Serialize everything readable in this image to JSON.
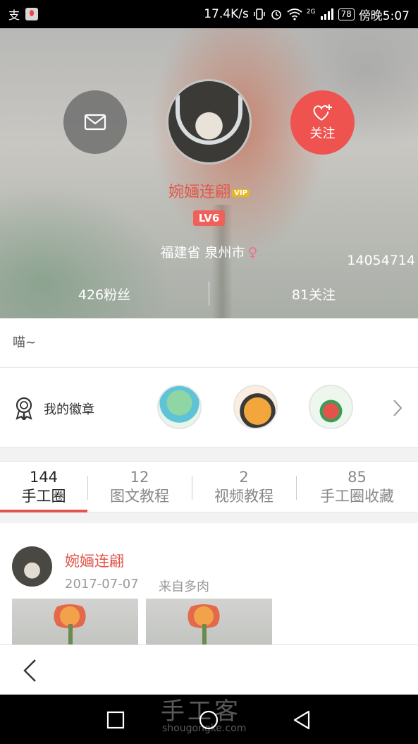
{
  "status_bar": {
    "network_speed": "17.4K/s",
    "network_type": "2G",
    "battery": "78",
    "time": "傍晚5:07",
    "icons": [
      "app-icon",
      "map-icon",
      "vibrate-icon",
      "alarm-icon",
      "wifi-icon",
      "signal-icon",
      "battery-icon"
    ]
  },
  "profile": {
    "username": "婉婳连翩",
    "vip_badge": "VIP",
    "level": "LV6",
    "location": "福建省 泉州市",
    "gender_symbol": "♀",
    "user_id": "14054714",
    "fans": "426粉丝",
    "following": "81关注",
    "follow_label": "关注",
    "bio": "喵~"
  },
  "badges": {
    "label": "我的徽章",
    "items": [
      "badge-1",
      "badge-2",
      "badge-3"
    ]
  },
  "tabs": [
    {
      "count": "144",
      "label": "手工圈",
      "active": true
    },
    {
      "count": "12",
      "label": "图文教程",
      "active": false
    },
    {
      "count": "2",
      "label": "视频教程",
      "active": false
    },
    {
      "count": "85",
      "label": "手工圈收藏",
      "active": false
    }
  ],
  "feed": {
    "post": {
      "author": "婉婳连翩",
      "date": "2017-07-07",
      "source": "来自多肉"
    }
  },
  "watermark": {
    "text": "手工客",
    "sub": "shougongke.com"
  },
  "colors": {
    "accent": "#e2574c",
    "follow_button": "#ef5350",
    "message_button": "#6e6e6e"
  }
}
